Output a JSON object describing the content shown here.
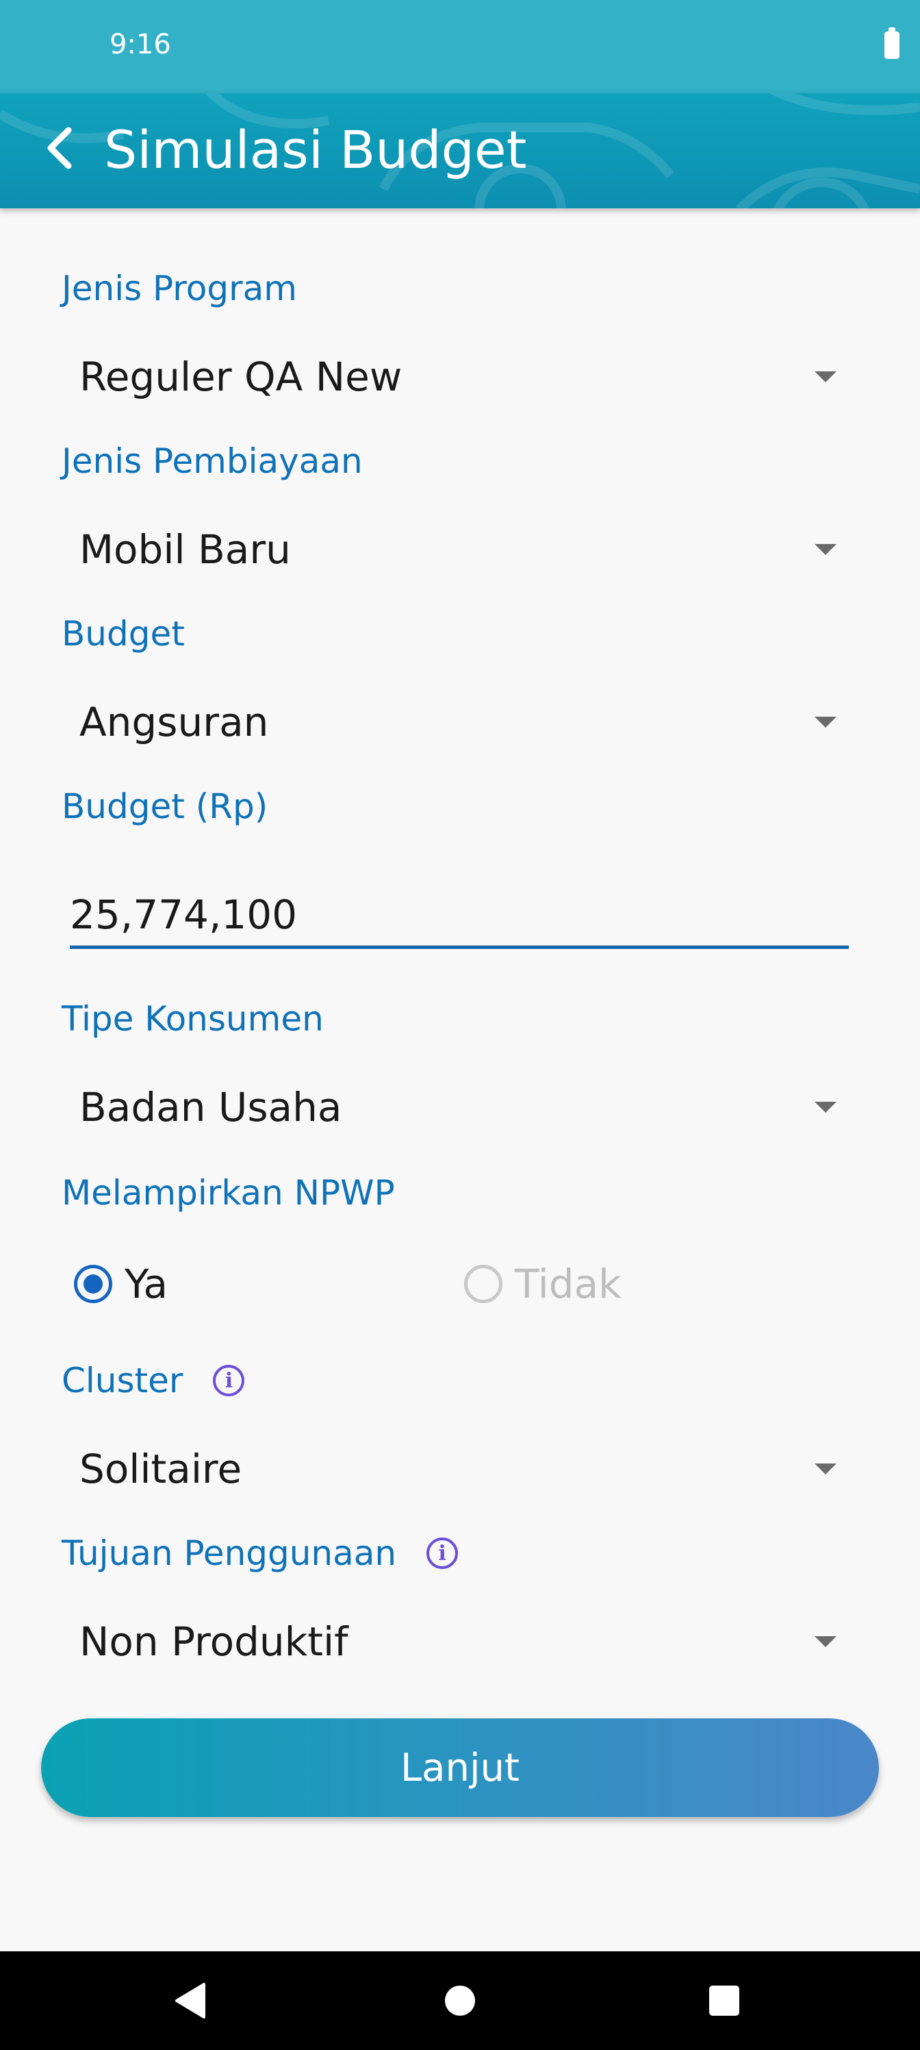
{
  "status_bar": {
    "time": "9:16"
  },
  "app_bar": {
    "title": "Simulasi Budget"
  },
  "form": {
    "jenis_program": {
      "label": "Jenis Program",
      "value": "Reguler QA New"
    },
    "jenis_pembiayaan": {
      "label": "Jenis Pembiayaan",
      "value": "Mobil Baru"
    },
    "budget": {
      "label": "Budget",
      "value": "Angsuran"
    },
    "budget_rp": {
      "label": "Budget (Rp)",
      "value": "25,774,100"
    },
    "tipe_konsumen": {
      "label": "Tipe Konsumen",
      "value": "Badan Usaha"
    },
    "npwp": {
      "label": "Melampirkan NPWP",
      "options": [
        "Ya",
        "Tidak"
      ],
      "selected": "Ya"
    },
    "cluster": {
      "label": "Cluster",
      "value": "Solitaire",
      "info_icon": "info-icon"
    },
    "tujuan": {
      "label": "Tujuan Penggunaan",
      "value": "Non Produktif",
      "info_icon": "info-icon"
    }
  },
  "submit_label": "Lanjut",
  "colors": {
    "label": "#0f72b8",
    "accent": "#1565c0",
    "status_bar": "#33b1c7",
    "app_bar": "#10a2bd",
    "button_start": "#0aa2b3",
    "button_end": "#4a87c8"
  }
}
